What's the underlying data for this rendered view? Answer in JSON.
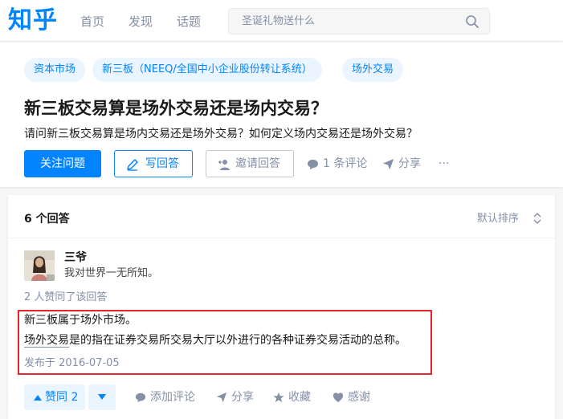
{
  "header": {
    "logo": "知乎",
    "nav": [
      "首页",
      "发现",
      "话题"
    ],
    "search_placeholder": "圣诞礼物送什么"
  },
  "question": {
    "topics": [
      "资本市场",
      "新三板（NEEQ/全国中小企业股份转让系统）",
      "场外交易"
    ],
    "title": "新三板交易算是场外交易还是场内交易？",
    "detail": "请问新三板交易算是场内交易还是场外交易？如何定义场内交易还是场外交易？",
    "actions": {
      "follow": "关注问题",
      "write": "写回答",
      "invite": "邀请回答",
      "comments": "1 条评论",
      "share": "分享",
      "more": "···"
    }
  },
  "answers": {
    "count": "6 个回答",
    "sort": "默认排序",
    "items": [
      {
        "author": "三爷",
        "bio": "我对世界一无所知。",
        "upvote_info": "2 人赞同了该回答",
        "text_line1": "新三板属于场外市场。",
        "text_link": "场外交易",
        "text_line2_rest": "是的指在证券交易所交易大厅以外进行的各种证券交易活动的总称。",
        "published": "发布于 2016-07-05",
        "actions": {
          "upvote": "赞同 2",
          "comment": "添加评论",
          "share": "分享",
          "collect": "收藏",
          "thanks": "感谢"
        }
      }
    ]
  },
  "colors": {
    "brand": "#0084ff",
    "highlight_box": "#e8242b",
    "muted": "#8590a6"
  }
}
